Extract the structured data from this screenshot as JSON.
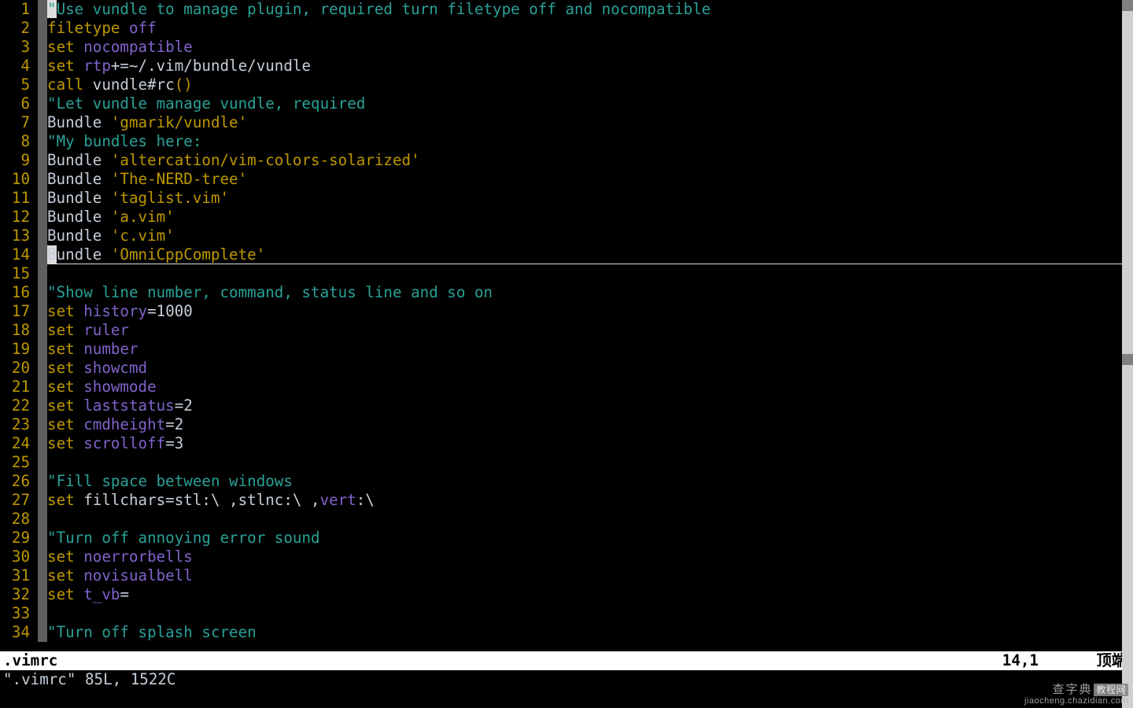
{
  "status": {
    "filename": ".vimrc",
    "position": "14,1",
    "scroll": "顶端"
  },
  "cmdline": "\".vimrc\" 85L, 1522C",
  "watermark": {
    "site_cn": "查字典",
    "site_box": "教程网",
    "url": "jiaocheng.chazidian.com"
  },
  "lines": [
    {
      "n": 1,
      "tokens": [
        {
          "c": "c-comment",
          "cursor": true,
          "t": "\""
        },
        {
          "c": "c-comment",
          "t": "Use vundle to manage plugin, required turn filetype off and nocompatible"
        }
      ]
    },
    {
      "n": 2,
      "tokens": [
        {
          "c": "c-kw",
          "t": "f"
        },
        {
          "c": "c-kw",
          "t": "iletype "
        },
        {
          "c": "c-opt",
          "t": "off"
        }
      ]
    },
    {
      "n": 3,
      "tokens": [
        {
          "c": "c-kw",
          "t": "s"
        },
        {
          "c": "c-kw",
          "t": "et "
        },
        {
          "c": "c-opt",
          "t": "nocompatible"
        }
      ]
    },
    {
      "n": 4,
      "tokens": [
        {
          "c": "c-kw",
          "t": "s"
        },
        {
          "c": "c-kw",
          "t": "et "
        },
        {
          "c": "c-opt",
          "t": "rtp"
        },
        {
          "c": "c-plain",
          "t": "+=~/.vim/bundle/vundle"
        }
      ]
    },
    {
      "n": 5,
      "tokens": [
        {
          "c": "c-kw",
          "t": "c"
        },
        {
          "c": "c-kw",
          "t": "all "
        },
        {
          "c": "c-plain",
          "t": "vundle#rc"
        },
        {
          "c": "c-str",
          "t": "()"
        }
      ]
    },
    {
      "n": 6,
      "tokens": [
        {
          "c": "c-comment",
          "t": "\""
        },
        {
          "c": "c-comment",
          "t": "Let vundle manage vundle, required"
        }
      ]
    },
    {
      "n": 7,
      "tokens": [
        {
          "c": "c-plain",
          "t": "Bundle "
        },
        {
          "c": "c-str",
          "t": "'gmarik/vundle'"
        }
      ]
    },
    {
      "n": 8,
      "tokens": [
        {
          "c": "c-comment",
          "t": "\""
        },
        {
          "c": "c-comment",
          "t": "My bundles here:"
        }
      ]
    },
    {
      "n": 9,
      "tokens": [
        {
          "c": "c-plain",
          "t": "Bundle "
        },
        {
          "c": "c-str",
          "t": "'altercation/vim-colors-solarized'"
        }
      ]
    },
    {
      "n": 10,
      "tokens": [
        {
          "c": "c-plain",
          "t": "Bundle "
        },
        {
          "c": "c-str",
          "t": "'The-NERD-tree'"
        }
      ]
    },
    {
      "n": 11,
      "tokens": [
        {
          "c": "c-plain",
          "t": "Bundle "
        },
        {
          "c": "c-str",
          "t": "'taglist.vim'"
        }
      ]
    },
    {
      "n": 12,
      "tokens": [
        {
          "c": "c-plain",
          "t": "Bundle "
        },
        {
          "c": "c-str",
          "t": "'a.vim'"
        }
      ]
    },
    {
      "n": 13,
      "tokens": [
        {
          "c": "c-plain",
          "t": "Bundle "
        },
        {
          "c": "c-str",
          "t": "'c.vim'"
        }
      ]
    },
    {
      "n": 14,
      "current": true,
      "tokens": [
        {
          "c": "c-plain",
          "cursor": true,
          "t": "B"
        },
        {
          "c": "c-plain",
          "t": "undle "
        },
        {
          "c": "c-str",
          "t": "'OmniCppComplete'"
        }
      ]
    },
    {
      "n": 15,
      "tokens": []
    },
    {
      "n": 16,
      "tokens": [
        {
          "c": "c-comment",
          "t": "\""
        },
        {
          "c": "c-comment",
          "t": "Show line number, command, status line and so on"
        }
      ]
    },
    {
      "n": 17,
      "tokens": [
        {
          "c": "c-kw",
          "t": "s"
        },
        {
          "c": "c-kw",
          "t": "et "
        },
        {
          "c": "c-opt",
          "t": "history"
        },
        {
          "c": "c-plain",
          "t": "=1000"
        }
      ]
    },
    {
      "n": 18,
      "tokens": [
        {
          "c": "c-kw",
          "t": "s"
        },
        {
          "c": "c-kw",
          "t": "et "
        },
        {
          "c": "c-opt",
          "t": "ruler"
        }
      ]
    },
    {
      "n": 19,
      "tokens": [
        {
          "c": "c-kw",
          "t": "s"
        },
        {
          "c": "c-kw",
          "t": "et "
        },
        {
          "c": "c-opt",
          "t": "number"
        }
      ]
    },
    {
      "n": 20,
      "tokens": [
        {
          "c": "c-kw",
          "t": "s"
        },
        {
          "c": "c-kw",
          "t": "et "
        },
        {
          "c": "c-opt",
          "t": "showcmd"
        }
      ]
    },
    {
      "n": 21,
      "tokens": [
        {
          "c": "c-kw",
          "t": "s"
        },
        {
          "c": "c-kw",
          "t": "et "
        },
        {
          "c": "c-opt",
          "t": "showmode"
        }
      ]
    },
    {
      "n": 22,
      "tokens": [
        {
          "c": "c-kw",
          "t": "s"
        },
        {
          "c": "c-kw",
          "t": "et "
        },
        {
          "c": "c-opt",
          "t": "laststatus"
        },
        {
          "c": "c-plain",
          "t": "=2"
        }
      ]
    },
    {
      "n": 23,
      "tokens": [
        {
          "c": "c-kw",
          "t": "s"
        },
        {
          "c": "c-kw",
          "t": "et "
        },
        {
          "c": "c-opt",
          "t": "cmdheight"
        },
        {
          "c": "c-plain",
          "t": "=2"
        }
      ]
    },
    {
      "n": 24,
      "tokens": [
        {
          "c": "c-kw",
          "t": "s"
        },
        {
          "c": "c-kw",
          "t": "et "
        },
        {
          "c": "c-opt",
          "t": "scrolloff"
        },
        {
          "c": "c-plain",
          "t": "=3"
        }
      ]
    },
    {
      "n": 25,
      "tokens": []
    },
    {
      "n": 26,
      "tokens": [
        {
          "c": "c-comment",
          "t": "\""
        },
        {
          "c": "c-comment",
          "t": "Fill space between windows"
        }
      ]
    },
    {
      "n": 27,
      "tokens": [
        {
          "c": "c-kw",
          "t": "s"
        },
        {
          "c": "c-kw",
          "t": "et "
        },
        {
          "c": "c-plain",
          "t": "fillchars=stl:\\ ,stlnc:\\ ,"
        },
        {
          "c": "c-opt",
          "t": "vert"
        },
        {
          "c": "c-plain",
          "t": ":\\ "
        }
      ]
    },
    {
      "n": 28,
      "tokens": []
    },
    {
      "n": 29,
      "tokens": [
        {
          "c": "c-comment",
          "t": "\""
        },
        {
          "c": "c-comment",
          "t": "Turn off annoying error sound"
        }
      ]
    },
    {
      "n": 30,
      "tokens": [
        {
          "c": "c-kw",
          "t": "s"
        },
        {
          "c": "c-kw",
          "t": "et "
        },
        {
          "c": "c-opt",
          "t": "noerrorbells"
        }
      ]
    },
    {
      "n": 31,
      "tokens": [
        {
          "c": "c-kw",
          "t": "s"
        },
        {
          "c": "c-kw",
          "t": "et "
        },
        {
          "c": "c-opt",
          "t": "novisualbell"
        }
      ]
    },
    {
      "n": 32,
      "tokens": [
        {
          "c": "c-kw",
          "t": "s"
        },
        {
          "c": "c-kw",
          "t": "et "
        },
        {
          "c": "c-opt",
          "t": "t_vb"
        },
        {
          "c": "c-plain",
          "t": "="
        }
      ]
    },
    {
      "n": 33,
      "tokens": []
    },
    {
      "n": 34,
      "tokens": [
        {
          "c": "c-comment",
          "t": "\""
        },
        {
          "c": "c-comment",
          "t": "Turn off splash screen"
        }
      ]
    }
  ]
}
